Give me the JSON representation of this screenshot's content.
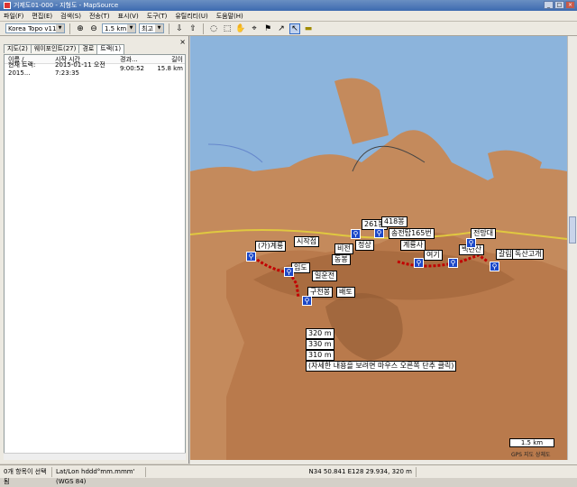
{
  "window": {
    "title": "거제도01-000 - 지형도 - MapSource"
  },
  "menu": [
    "파일(F)",
    "편집(E)",
    "검색(S)",
    "전송(T)",
    "표시(V)",
    "도구(T)",
    "유틸리티(U)",
    "도움말(H)"
  ],
  "toolbar": {
    "map_product": "Korea Topo v11",
    "scale": "1.5 km",
    "detail": "최고"
  },
  "panel": {
    "tabs": [
      "지도(2)",
      "웨이포인트(27)",
      "경로",
      "트랙(1)"
    ],
    "columns": [
      "이름",
      "시작 시간",
      "경과...",
      "길이"
    ],
    "rows": [
      {
        "name": "현재 트랙: 2015...",
        "start": "2015-01-11 오전 7:23:35",
        "elapsed": "9:00:52",
        "length": "15.8 km"
      }
    ]
  },
  "map": {
    "labels": [
      "261봉",
      "418봉",
      "송전탑165번",
      "계룡사",
      "(가)계룡",
      "시작점",
      "비전",
      "동봉",
      "임도",
      "일운전",
      "배토",
      "전망대",
      "여기",
      "구천봉",
      "백련산",
      "갈림길",
      "독산고개",
      "정상",
      "320 m",
      "330 m",
      "310 m",
      "(자세한 내용을 보려면 마우스 오른쪽 단추 클릭)"
    ],
    "scale_label": "1.5 km",
    "credit": "GPS 지도 상체도"
  },
  "status": {
    "selection": "0개 항목이 선택됨",
    "coord_format": "Lat/Lon hddd°mm.mmm' (WGS 84)",
    "position": "N34 50.841 E128 29.934, 320 m"
  }
}
